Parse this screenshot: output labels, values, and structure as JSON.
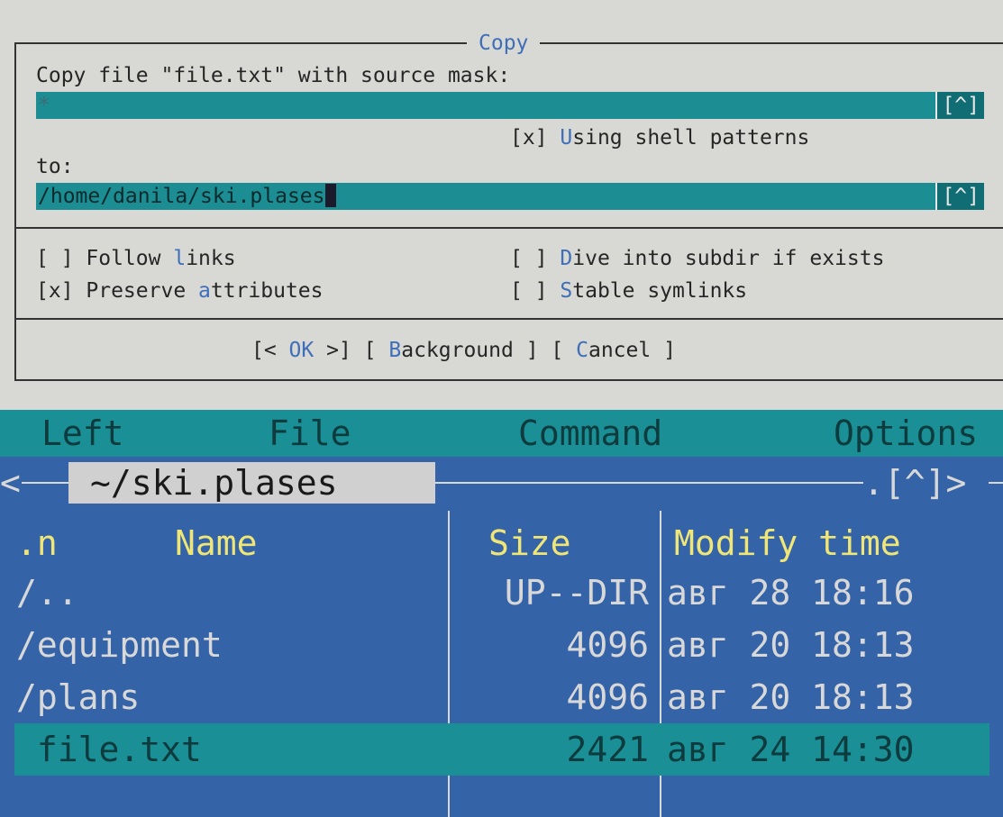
{
  "dialog": {
    "title": "Copy",
    "source_label": "Copy file \"file.txt\" with source mask:",
    "source_value": "*",
    "history_button": "[^]",
    "shell_patterns": {
      "box": "[x] ",
      "hot": "U",
      "rest": "sing shell patterns"
    },
    "to_label": "to:",
    "to_value": "/home/danila/ski.plases",
    "options": {
      "follow_links": {
        "box": "[ ] ",
        "pre": "Follow ",
        "hot": "l",
        "post": "inks"
      },
      "preserve_attributes": {
        "box": "[x] ",
        "pre": "Preserve ",
        "hot": "a",
        "post": "ttributes"
      },
      "dive_into_subdir": {
        "box": "[ ] ",
        "pre": "",
        "hot": "D",
        "post": "ive into subdir if exists"
      },
      "stable_symlinks": {
        "box": "[ ] ",
        "pre": "",
        "hot": "S",
        "post": "table symlinks"
      }
    },
    "buttons": {
      "ok": {
        "open": "[< ",
        "label": "OK",
        "close": " >]"
      },
      "background": {
        "open": "[ ",
        "hot": "B",
        "rest": "ackground",
        "close": " ]"
      },
      "cancel": {
        "open": "[ ",
        "hot": "C",
        "rest": "ancel",
        "close": " ]"
      }
    }
  },
  "menubar": {
    "left": "Left",
    "file": "File",
    "command": "Command",
    "options": "Options"
  },
  "panel": {
    "nav_left": "<",
    "path": "~/ski.plases",
    "nav_right": ".[^]>",
    "columns": {
      "sort": ".n",
      "name": "Name",
      "size": "Size",
      "mtime": "Modify time"
    },
    "rows": [
      {
        "name": "/..",
        "size": "UP--DIR",
        "mtime": "авг 28 18:16"
      },
      {
        "name": "/equipment",
        "size": "4096",
        "mtime": "авг 20 18:13"
      },
      {
        "name": "/plans",
        "size": "4096",
        "mtime": "авг 20 18:13"
      },
      {
        "name": " file.txt",
        "size": "2421",
        "mtime": "авг 24 14:30"
      }
    ]
  },
  "colors": {
    "dialog_bg": "#d8d8d5",
    "input_bg": "#1b8d93",
    "hotkey": "#3f6fb8",
    "panel_bg": "#3463a8",
    "header_text": "#f0e678",
    "selection_bg": "#1a8f95"
  }
}
